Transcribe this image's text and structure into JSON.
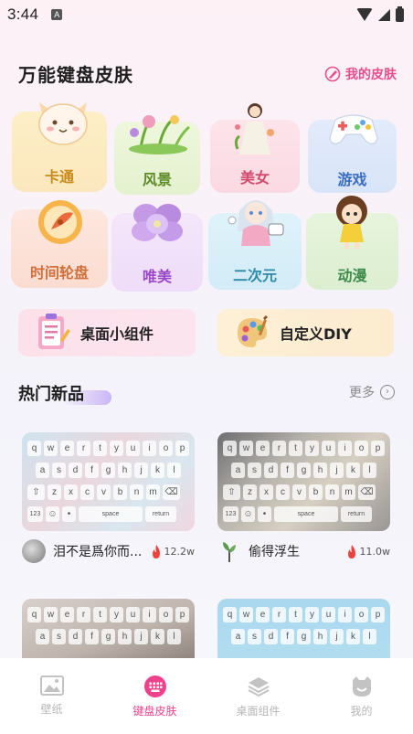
{
  "status_bar": {
    "time": "3:44",
    "notification_badge": "A"
  },
  "header": {
    "title": "万能键盘皮肤",
    "my_skin_label": "我的皮肤"
  },
  "categories": [
    {
      "label": "卡通",
      "icon": "cat-figure-icon",
      "color": "#c88a1a"
    },
    {
      "label": "风景",
      "icon": "flower-landscape-icon",
      "color": "#5e8a28"
    },
    {
      "label": "美女",
      "icon": "girl-figure-icon",
      "color": "#d24a6e"
    },
    {
      "label": "游戏",
      "icon": "gamepad-icon",
      "color": "#3a6cc4"
    },
    {
      "label": "时间轮盘",
      "icon": "clock-wheel-icon",
      "color": "#d0703c"
    },
    {
      "label": "唯美",
      "icon": "purple-flower-icon",
      "color": "#9a48c8"
    },
    {
      "label": "二次元",
      "icon": "anime-girl-icon",
      "color": "#2d8aa8"
    },
    {
      "label": "动漫",
      "icon": "doll-figure-icon",
      "color": "#3d8b4d"
    }
  ],
  "widgets": [
    {
      "label": "桌面小组件",
      "icon": "clipboard-icon"
    },
    {
      "label": "自定义DIY",
      "icon": "palette-icon"
    }
  ],
  "hot_section": {
    "title": "热门新品",
    "more_label": "更多"
  },
  "keyboard_labels": {
    "row1": [
      "q",
      "w",
      "e",
      "r",
      "t",
      "y",
      "u",
      "i",
      "o",
      "p"
    ],
    "row2": [
      "a",
      "s",
      "d",
      "f",
      "g",
      "h",
      "j",
      "k",
      "l"
    ],
    "row3": [
      "z",
      "x",
      "c",
      "v",
      "b",
      "n",
      "m"
    ],
    "num_key": "123",
    "space_key": "space",
    "return_key": "return"
  },
  "products": [
    {
      "title": "泪不是爲你而...",
      "count": "12.2w"
    },
    {
      "title": "偷得浮生",
      "count": "11.0w"
    }
  ],
  "bottom_nav": [
    {
      "label": "壁纸",
      "icon": "image-icon",
      "active": false
    },
    {
      "label": "键盘皮肤",
      "icon": "keyboard-icon",
      "active": true
    },
    {
      "label": "桌面组件",
      "icon": "layers-icon",
      "active": false
    },
    {
      "label": "我的",
      "icon": "smiley-icon",
      "active": false
    }
  ]
}
